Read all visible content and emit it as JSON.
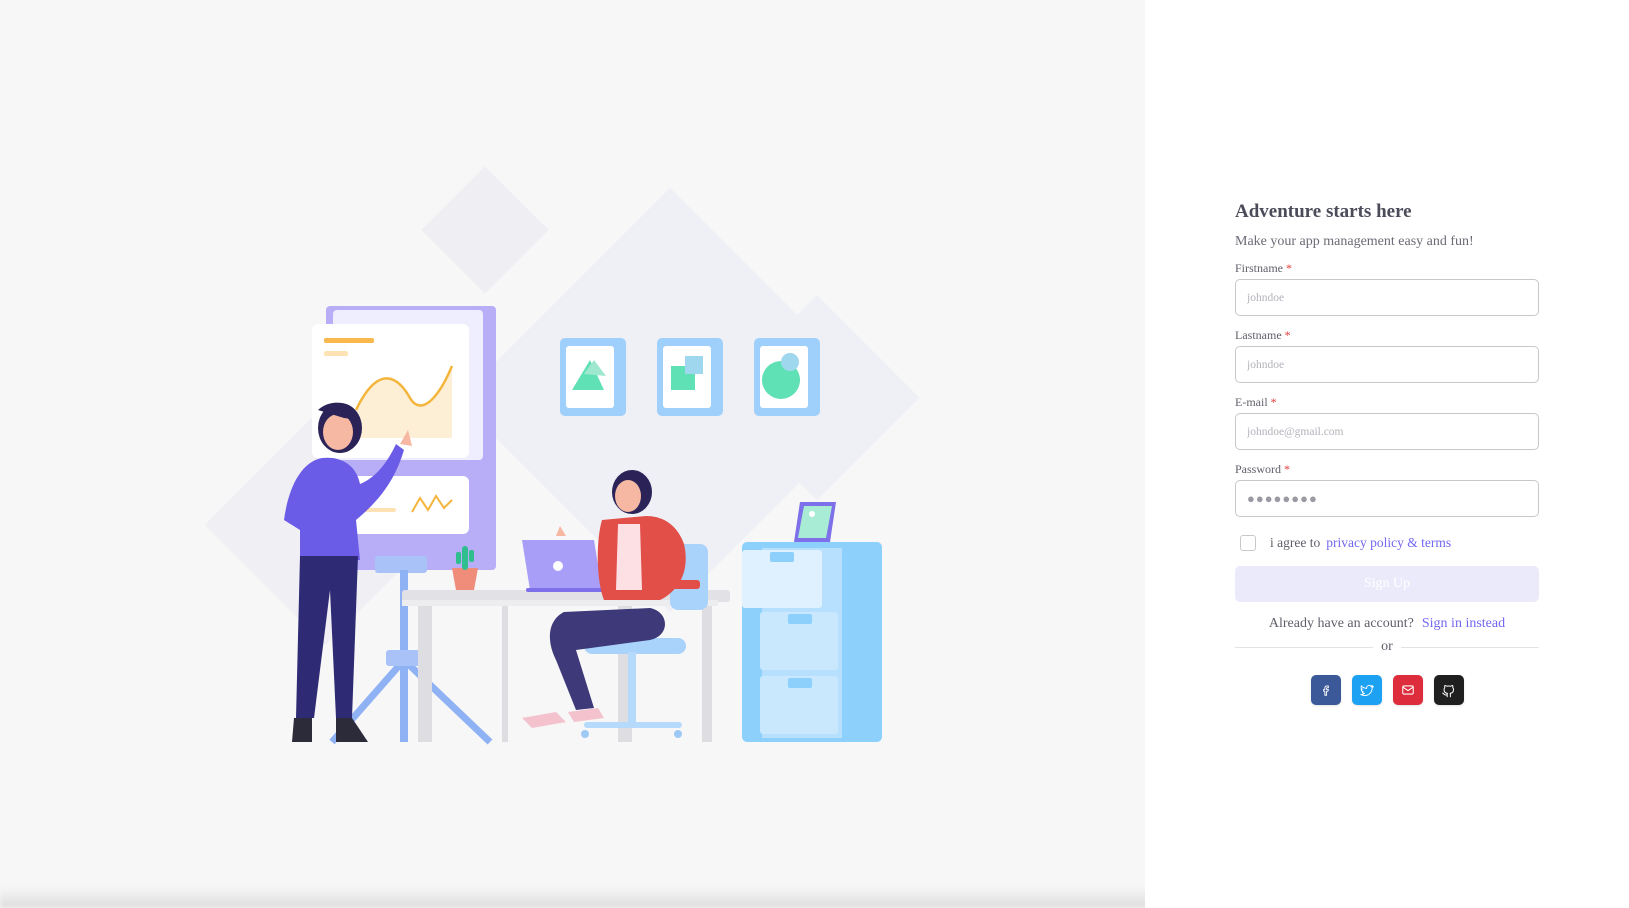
{
  "form": {
    "title": "Adventure starts here",
    "subtitle": "Make your app management easy and fun!",
    "fields": [
      {
        "label": "Firstname",
        "required_mark": "*",
        "placeholder": "johndoe"
      },
      {
        "label": "Lastname",
        "required_mark": "*",
        "placeholder": "johndoe"
      },
      {
        "label": "E-mail",
        "required_mark": "*",
        "placeholder": "johndoe@gmail.com"
      },
      {
        "label": "Password",
        "required_mark": "*",
        "value_masked": "●●●●●●●●"
      }
    ],
    "agree_text": "i agree to",
    "privacy_link": "privacy policy & terms",
    "submit_label": "Sign Up",
    "account_text": "Already have an account?",
    "signin_link": "Sign in instead",
    "divider_text": "or"
  },
  "socials": [
    {
      "name": "facebook",
      "icon": "facebook-icon",
      "color": "#3b5998"
    },
    {
      "name": "twitter",
      "icon": "twitter-icon",
      "color": "#1da1f2"
    },
    {
      "name": "mail",
      "icon": "mail-icon",
      "color": "#dd2c3c"
    },
    {
      "name": "github",
      "icon": "github-icon",
      "color": "#1f1f1f"
    }
  ],
  "colors": {
    "accent": "#7367f0",
    "left_background": "#f7f7f7",
    "disabled_button": "#ebeafb"
  }
}
